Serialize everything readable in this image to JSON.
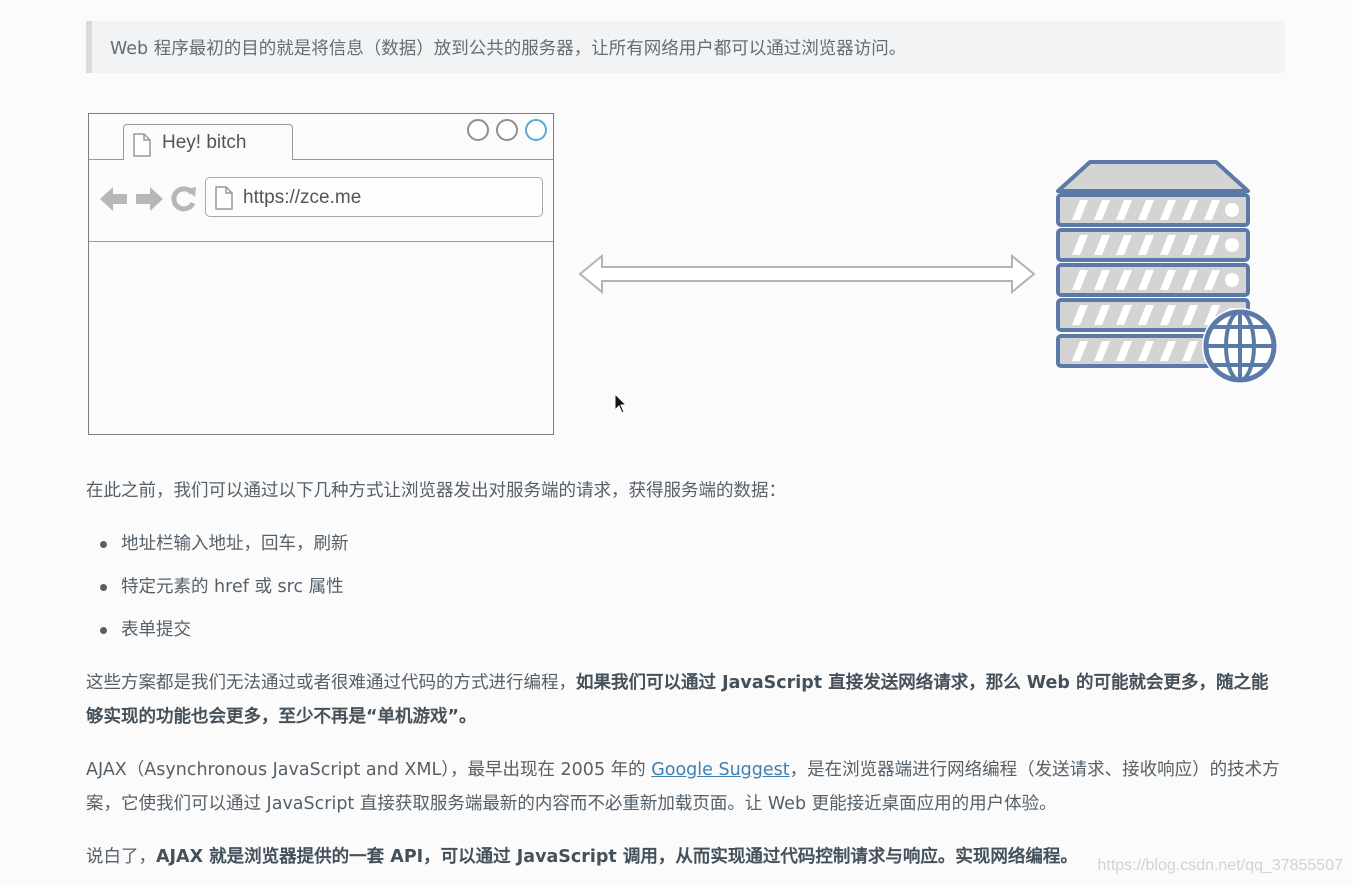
{
  "intro": "Web 程序最初的目的就是将信息（数据）放到公共的服务器，让所有网络用户都可以通过浏览器访问。",
  "browser": {
    "tab_title": "Hey! bitch",
    "url": "https://zce.me"
  },
  "para1": "在此之前，我们可以通过以下几种方式让浏览器发出对服务端的请求，获得服务端的数据：",
  "list": [
    "地址栏输入地址，回车，刷新",
    "特定元素的 href 或 src 属性",
    "表单提交"
  ],
  "para2": {
    "normal": "这些方案都是我们无法通过或者很难通过代码的方式进行编程，",
    "bold": "如果我们可以通过 JavaScript 直接发送网络请求，那么 Web 的可能就会更多，随之能够实现的功能也会更多，至少不再是“单机游戏”。"
  },
  "para3": {
    "before": "AJAX（Asynchronous JavaScript and XML），最早出现在 2005 年的 ",
    "link": "Google Suggest",
    "after": "，是在浏览器端进行网络编程（发送请求、接收响应）的技术方案，它使我们可以通过 JavaScript 直接获取服务端最新的内容而不必重新加载页面。让 Web 更能接近桌面应用的用户体验。"
  },
  "para4": {
    "normal": "说白了，",
    "bold": "AJAX 就是浏览器提供的一套 API，可以通过 JavaScript 调用，从而实现通过代码控制请求与响应。实现网络编程。"
  },
  "watermark": "https://blog.csdn.net/qq_37855507",
  "icons": {
    "server": "server-icon",
    "globe": "globe-icon",
    "arrow": "double-arrow-icon",
    "cursor": "mouse-cursor-icon"
  },
  "colors": {
    "server_blue": "#5b7aa8",
    "link": "#3f7fb0",
    "window_button_active": "#5aa9d8"
  }
}
